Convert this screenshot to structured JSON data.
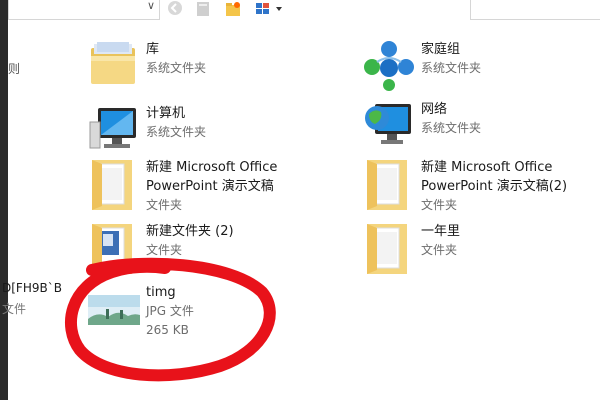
{
  "nav": {
    "fragment_top": "则",
    "fragment_item": "D[FH9B`B",
    "fragment_type": "文件"
  },
  "items": [
    {
      "name": "库",
      "type": "系统文件夹",
      "icon": "library-icon"
    },
    {
      "name": "家庭组",
      "type": "系统文件夹",
      "icon": "homegroup-icon"
    },
    {
      "name": "计算机",
      "type": "系统文件夹",
      "icon": "computer-icon"
    },
    {
      "name": "网络",
      "type": "系统文件夹",
      "icon": "network-icon"
    },
    {
      "name": "新建 Microsoft Office",
      "name2": "PowerPoint 演示文稿",
      "type": "文件夹",
      "icon": "folder-icon"
    },
    {
      "name": "新建 Microsoft Office",
      "name2": "PowerPoint 演示文稿(2)",
      "type": "文件夹",
      "icon": "folder-icon"
    },
    {
      "name": "新建文件夹 (2)",
      "type": "文件夹",
      "icon": "folder-icon"
    },
    {
      "name": "一年里",
      "type": "文件夹",
      "icon": "folder-icon"
    },
    {
      "name": "timg",
      "type": "JPG 文件",
      "size": "265 KB",
      "icon": "image-thumbnail-icon"
    }
  ],
  "colors": {
    "annotation": "#e8121a",
    "folder": "#f4d57e",
    "secondary_text": "#6d6d6d"
  }
}
